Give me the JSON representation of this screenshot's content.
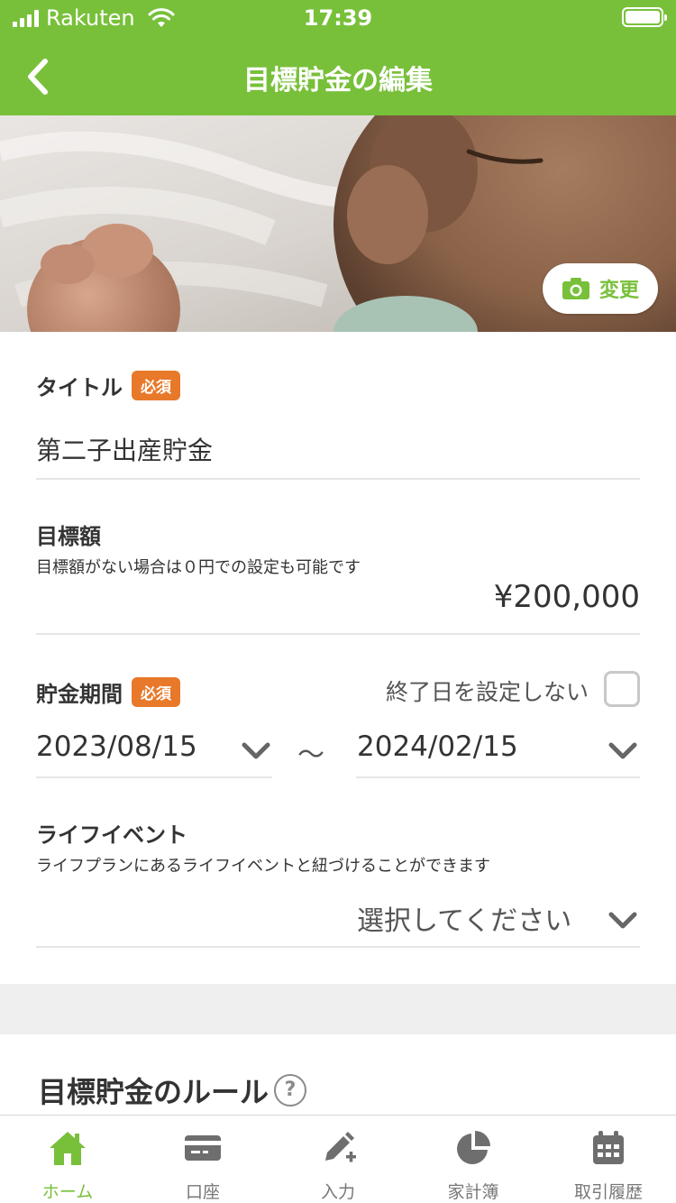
{
  "status_bar": {
    "carrier": "Rakuten",
    "time": "17:39"
  },
  "header": {
    "title": "目標貯金の編集"
  },
  "photo": {
    "change_label": "変更"
  },
  "form": {
    "title_field": {
      "label": "タイトル",
      "badge": "必須",
      "value": "第二子出産貯金"
    },
    "target_amount": {
      "label": "目標額",
      "hint": "目標額がない場合は０円での設定も可能です",
      "value": "¥200,000"
    },
    "period": {
      "label": "貯金期間",
      "badge": "必須",
      "no_end_label": "終了日を設定しない",
      "no_end_checked": false,
      "start_date": "2023/08/15",
      "separator": "〜",
      "end_date": "2024/02/15"
    },
    "life_event": {
      "label": "ライフイベント",
      "hint": "ライフプランにあるライフイベントと紐づけることができます",
      "placeholder": "選択してください"
    }
  },
  "rules_section": {
    "title": "目標貯金のルール",
    "help": "?"
  },
  "tabbar": {
    "items": [
      {
        "label": "ホーム",
        "icon": "home-icon",
        "active": true
      },
      {
        "label": "口座",
        "icon": "card-icon",
        "active": false
      },
      {
        "label": "入力",
        "icon": "pen-plus-icon",
        "active": false
      },
      {
        "label": "家計簿",
        "icon": "pie-chart-icon",
        "active": false
      },
      {
        "label": "取引履歴",
        "icon": "calendar-icon",
        "active": false
      }
    ]
  },
  "colors": {
    "brand_green": "#78c03a",
    "required_orange": "#e8792a"
  }
}
